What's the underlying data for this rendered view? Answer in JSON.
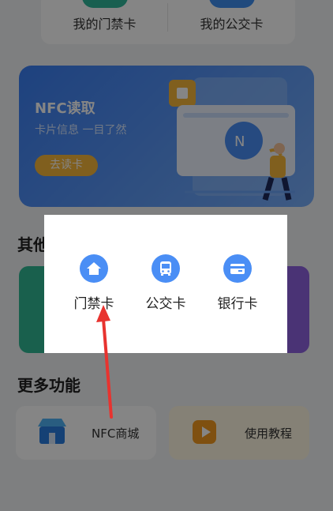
{
  "top_cards": {
    "left_label": "我的门禁卡",
    "right_label": "我的公交卡"
  },
  "banner": {
    "title": "NFC读取",
    "subtitle": "卡片信息 一目了然",
    "button": "去读卡"
  },
  "sections": {
    "other": "其他",
    "more": "更多功能"
  },
  "features": [
    {
      "label": "NFC商城",
      "icon": "store-icon"
    },
    {
      "label": "使用教程",
      "icon": "play-icon"
    }
  ],
  "dialog": {
    "options": [
      {
        "label": "门禁卡",
        "icon": "home-icon"
      },
      {
        "label": "公交卡",
        "icon": "bus-icon"
      },
      {
        "label": "银行卡",
        "icon": "bank-card-icon"
      }
    ]
  },
  "colors": {
    "accent": "#4a8ef5",
    "arrow": "#e8332f"
  }
}
